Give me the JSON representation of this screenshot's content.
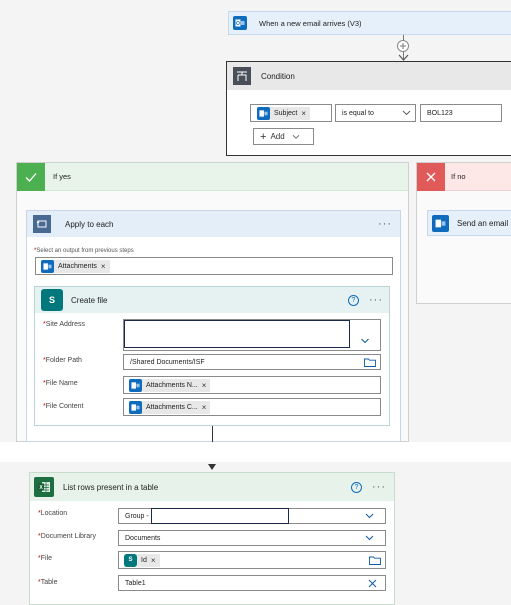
{
  "trigger": {
    "title": "When a new email arrives (V3)"
  },
  "condition": {
    "title": "Condition",
    "token_label": "Subject",
    "operator": "is equal to",
    "value": "BOL123",
    "add_label": "Add",
    "add_symbol": "+"
  },
  "if_yes": {
    "label": "If yes",
    "apply": {
      "title": "Apply to each",
      "select_label": "Select an output from previous steps",
      "token_label": "Attachments",
      "create_file": {
        "title": "Create file",
        "site_address_label": "Site Address",
        "site_address_value": "",
        "folder_path_label": "Folder Path",
        "folder_path_value": "/Shared Documents/ISF",
        "file_name_label": "File Name",
        "file_name_token": "Attachments N...",
        "file_content_label": "File Content",
        "file_content_token": "Attachments C..."
      }
    }
  },
  "if_no": {
    "label": "If no",
    "send_email_title": "Send an email"
  },
  "list_rows": {
    "title": "List rows present in a table",
    "location_label": "Location",
    "location_value": "Group -",
    "location_redacted": "",
    "document_library_label": "Document Library",
    "document_library_value": "Documents",
    "file_label": "File",
    "file_token": "Id",
    "table_label": "Table",
    "table_value": "Table1"
  },
  "symbols": {
    "required": "*",
    "remove": "×",
    "more": "···",
    "help": "?"
  },
  "colors": {
    "yes_header": "#e8f4e9",
    "yes_check": "#4caf50",
    "no_header": "#fde7e7",
    "no_x": "#e05a5a",
    "trigger_header": "#e6f0fa",
    "condition_header": "#e8e8e8",
    "apply_header": "#e3eef8",
    "create_header": "#e6f2f2",
    "excel_header": "#e6f2ea",
    "outlook_blue": "#0f6cbd",
    "excel_green": "#1d6f42",
    "sharepoint_teal": "#03787c"
  },
  "icons": [
    "outlook-icon",
    "condition-icon",
    "check-icon",
    "close-icon",
    "loop-icon",
    "sharepoint-icon",
    "excel-icon",
    "help-icon",
    "more-icon",
    "chevron-down-icon",
    "folder-icon",
    "plus-icon",
    "arrow-down-icon"
  ]
}
